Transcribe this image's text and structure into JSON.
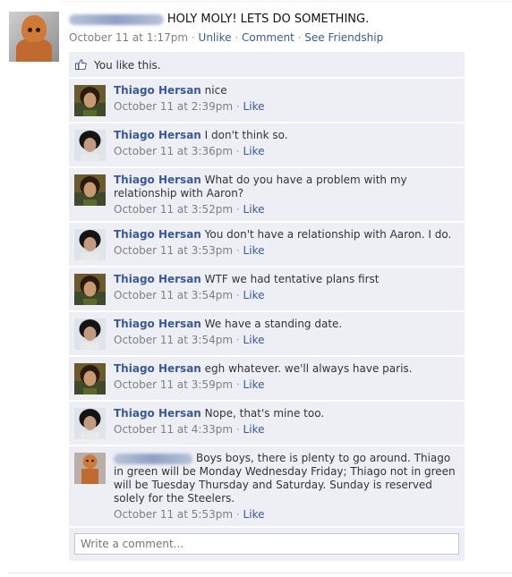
{
  "post": {
    "author_redacted": true,
    "message": "HOLY MOLY! LETS DO SOMETHING.",
    "timestamp": "October 11 at 1:17pm",
    "actions": [
      "Unlike",
      "Comment",
      "See Friendship"
    ],
    "separator": "·"
  },
  "likes": {
    "text": "You like this.",
    "icon": "like-thumb-icon"
  },
  "comments": [
    {
      "author": "Thiago Hersan",
      "text": "nice",
      "time": "October 11 at 2:39pm",
      "like": "Like",
      "avatar": "a"
    },
    {
      "author": "Thiago Hersan",
      "text": "I don't think so.",
      "time": "October 11 at 3:36pm",
      "like": "Like",
      "avatar": "b"
    },
    {
      "author": "Thiago Hersan",
      "text": "What do you have a problem with my relationship with Aaron?",
      "time": "October 11 at 3:52pm",
      "like": "Like",
      "avatar": "a"
    },
    {
      "author": "Thiago Hersan",
      "text": "You don't have a relationship with Aaron. I do.",
      "time": "October 11 at 3:53pm",
      "like": "Like",
      "avatar": "b"
    },
    {
      "author": "Thiago Hersan",
      "text": "WTF we had tentative plans first",
      "time": "October 11 at 3:54pm",
      "like": "Like",
      "avatar": "a"
    },
    {
      "author": "Thiago Hersan",
      "text": "We have a standing date.",
      "time": "October 11 at 3:54pm",
      "like": "Like",
      "avatar": "b"
    },
    {
      "author": "Thiago Hersan",
      "text": "egh whatever. we'll always have paris.",
      "time": "October 11 at 3:59pm",
      "like": "Like",
      "avatar": "a"
    },
    {
      "author": "Thiago Hersan",
      "text": "Nope, that's mine too.",
      "time": "October 11 at 4:33pm",
      "like": "Like",
      "avatar": "b"
    },
    {
      "author": "",
      "author_redacted": true,
      "text": "Boys boys, there is plenty to go around. Thiago in green will be Monday Wednesday Friday; Thiago not in green will be Tuesday Thursday and Saturday. Sunday is reserved solely for the Steelers.",
      "time": "October 11 at 5:53pm",
      "like": "Like",
      "avatar": "c"
    }
  ],
  "composer": {
    "placeholder": "Write a comment..."
  },
  "colors": {
    "link": "#3b5998",
    "panel": "#edeff4",
    "meta": "#7f7f7f"
  }
}
